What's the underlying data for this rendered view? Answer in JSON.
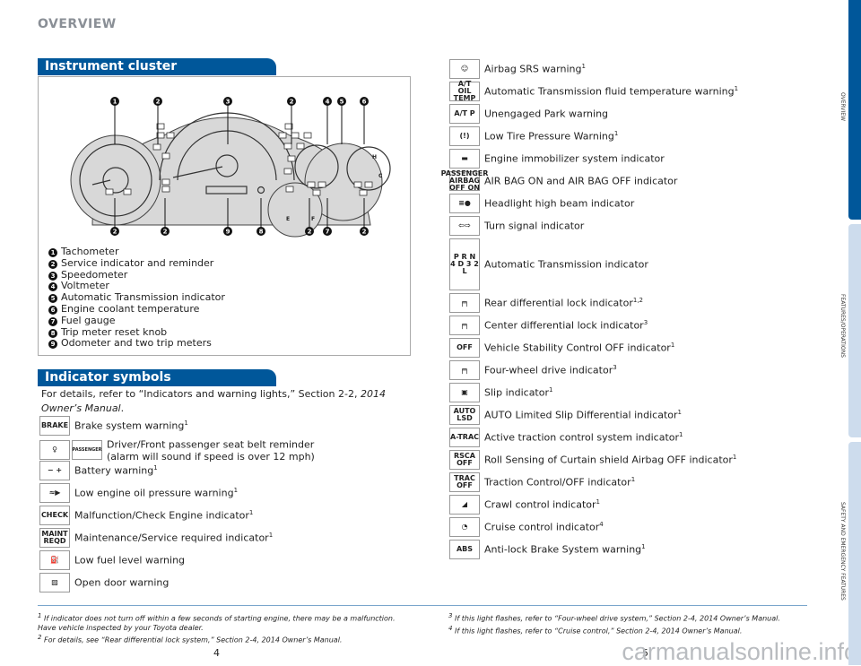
{
  "header": "OVERVIEW",
  "cluster": {
    "title": "Instrument cluster",
    "callouts_top": [
      "1",
      "2",
      "3",
      "2",
      "4",
      "5",
      "6"
    ],
    "callouts_bottom": [
      "2",
      "2",
      "9",
      "8",
      "2",
      "7",
      "2"
    ],
    "gauge_labels": {
      "h": "H",
      "c": "C",
      "e": "E",
      "f": "F",
      "gears": [
        "P",
        "R",
        "N",
        "4",
        "D",
        "3",
        "2",
        "L"
      ]
    },
    "legend": [
      {
        "n": "1",
        "label": "Tachometer"
      },
      {
        "n": "2",
        "label": "Service indicator and reminder"
      },
      {
        "n": "3",
        "label": "Speedometer"
      },
      {
        "n": "4",
        "label": "Voltmeter"
      },
      {
        "n": "5",
        "label": "Automatic Transmission indicator"
      },
      {
        "n": "6",
        "label": "Engine coolant temperature"
      },
      {
        "n": "7",
        "label": "Fuel gauge"
      },
      {
        "n": "8",
        "label": "Trip meter reset knob"
      },
      {
        "n": "9",
        "label": "Odometer and two trip meters"
      }
    ]
  },
  "indicators": {
    "title": "Indicator symbols",
    "intro": "For details, refer to “Indicators and warning lights,” Section 2-2, ",
    "intro_italic": "2014 Owner’s Manual",
    "intro_end": ".",
    "left": [
      {
        "icon": "brake-icon",
        "text": "BRAKE",
        "label": "Brake system warning",
        "sup": "1"
      },
      {
        "icon": "seatbelt-icon",
        "icon2": "passenger-seatbelt-icon",
        "text2": "PASSENGER",
        "label": "Driver/Front passenger seat belt reminder",
        "label2": "(alarm will sound if speed is over 12 mph)",
        "sup": ""
      },
      {
        "icon": "battery-icon",
        "text": "− +",
        "label": "Battery warning",
        "sup": "1"
      },
      {
        "icon": "oil-pressure-icon",
        "text": "≈▶",
        "label": "Low engine oil pressure warning",
        "sup": "1"
      },
      {
        "icon": "check-engine-icon",
        "text": "CHECK",
        "label": "Malfunction/Check Engine indicator",
        "sup": "1"
      },
      {
        "icon": "maintenance-icon",
        "text": "MAINT REQD",
        "label": "Maintenance/Service required indicator",
        "sup": "1"
      },
      {
        "icon": "fuel-pump-icon",
        "text": "⛽",
        "label": "Low fuel level warning",
        "sup": ""
      },
      {
        "icon": "open-door-icon",
        "text": "▨",
        "label": "Open door warning",
        "sup": ""
      }
    ],
    "right": [
      {
        "icon": "airbag-icon",
        "text": "☺",
        "label": "Airbag SRS warning",
        "sup": "1"
      },
      {
        "icon": "at-oil-temp-icon",
        "text": "A/T OIL TEMP",
        "label": "Automatic Transmission fluid temperature warning",
        "sup": "1"
      },
      {
        "icon": "at-p-icon",
        "text": "A/T P",
        "label": "Unengaged Park warning",
        "sup": ""
      },
      {
        "icon": "tire-pressure-icon",
        "text": "(!)",
        "label": "Low Tire Pressure Warning",
        "sup": "1"
      },
      {
        "icon": "immobilizer-icon",
        "text": "▬",
        "label": "Engine immobilizer system indicator",
        "sup": ""
      },
      {
        "icon": "passenger-airbag-icon",
        "text": "PASSENGER AIRBAG OFF ON",
        "label": "AIR BAG ON and AIR BAG OFF indicator",
        "sup": ""
      },
      {
        "icon": "high-beam-icon",
        "text": "≡●",
        "label": "Headlight high beam indicator",
        "sup": ""
      },
      {
        "icon": "turn-signal-icon",
        "text": "⇦⇨",
        "label": "Turn signal indicator",
        "sup": ""
      },
      {
        "icon": "at-indicator-icon",
        "text": "P R N 4 D 3 2 L",
        "label": "Automatic Transmission indicator",
        "sup": ""
      },
      {
        "icon": "rear-diff-lock-icon",
        "text": "╒╕",
        "label": "Rear differential lock indicator",
        "sup": "1,2"
      },
      {
        "icon": "center-diff-lock-icon",
        "text": "╒╕",
        "label": "Center differential lock indicator",
        "sup": "3"
      },
      {
        "icon": "vsc-off-icon",
        "text": "OFF",
        "label": "Vehicle Stability Control OFF indicator",
        "sup": "1"
      },
      {
        "icon": "four-wheel-drive-icon",
        "text": "╒╕",
        "label": "Four-wheel drive indicator",
        "sup": "3"
      },
      {
        "icon": "slip-icon",
        "text": "▣",
        "label": "Slip indicator",
        "sup": "1"
      },
      {
        "icon": "auto-lsd-icon",
        "text": "AUTO LSD",
        "label": "AUTO Limited Slip Differential indicator",
        "sup": "1"
      },
      {
        "icon": "a-trac-icon",
        "text": "A-TRAC",
        "label": "Active traction control system indicator",
        "sup": "1"
      },
      {
        "icon": "rsca-off-icon",
        "text": "RSCA OFF",
        "label": "Roll Sensing of Curtain shield Airbag OFF indicator",
        "sup": "1"
      },
      {
        "icon": "trac-off-icon",
        "text": "TRAC OFF",
        "label": "Traction Control/OFF indicator",
        "sup": "1"
      },
      {
        "icon": "crawl-control-icon",
        "text": "◢",
        "label": "Crawl control indicator",
        "sup": "1"
      },
      {
        "icon": "cruise-control-icon",
        "text": "◔",
        "label": "Cruise control indicator",
        "sup": "4"
      },
      {
        "icon": "abs-icon",
        "text": "ABS",
        "label": "Anti-lock Brake System warning",
        "sup": "1"
      }
    ]
  },
  "footnotes": {
    "f1": "If indicator does not turn off within a few seconds of starting engine, there may be a malfunction. Have vehicle inspected by your Toyota dealer.",
    "f2": "For details, see “Rear differential lock system,” Section 2-4, 2014 Owner’s Manual.",
    "f3": "If this light flashes, refer to “Four-wheel drive system,” Section 2-4, 2014 Owner’s Manual.",
    "f4": "If this light flashes, refer to “Cruise control,” Section 2-4, 2014 Owner’s Manual.",
    "n1": "1",
    "n2": "2",
    "n3": "3",
    "n4": "4"
  },
  "pages": {
    "left": "4",
    "right": "5"
  },
  "side_tabs": [
    {
      "label": "OVERVIEW",
      "active": true
    },
    {
      "label": "FEATURES/OPERATIONS",
      "active": false
    },
    {
      "label": "SAFETY AND EMERGENCY FEATURES",
      "active": false
    }
  ],
  "colors": {
    "accent": "#00579a",
    "tab_inactive": "#cddced"
  },
  "watermark": "carmanualsonline.info"
}
